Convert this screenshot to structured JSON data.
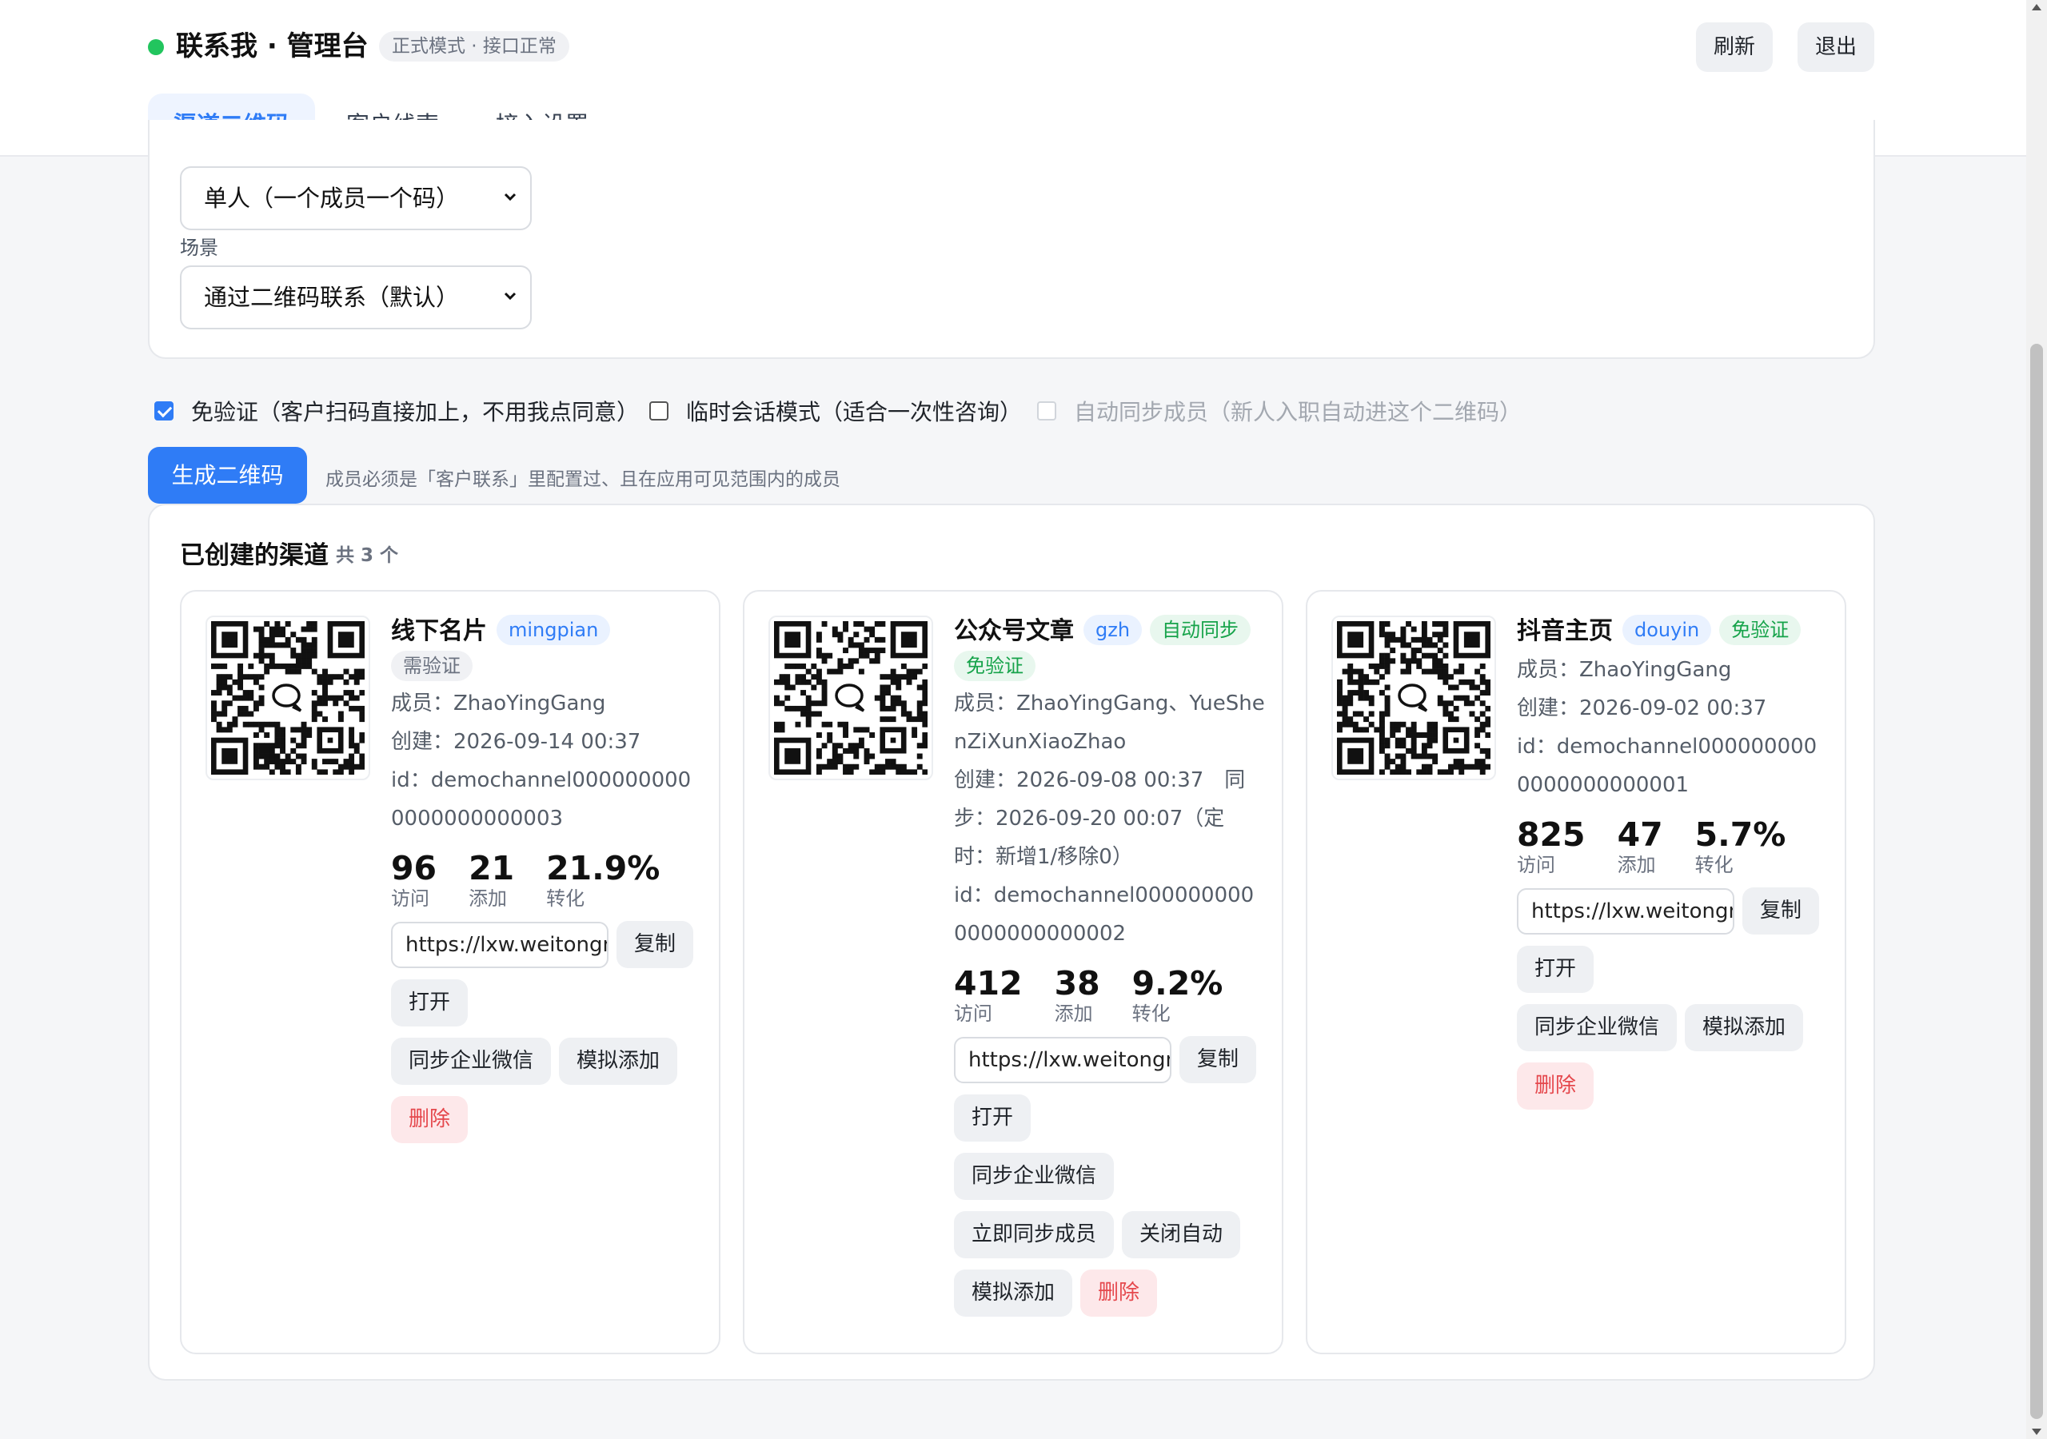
{
  "header": {
    "title": "联系我 · 管理台",
    "mode_badge": "正式模式 · 接口正常",
    "refresh_label": "刷新",
    "logout_label": "退出",
    "status_color": "#22c55e"
  },
  "tabs": [
    {
      "label": "渠道二维码",
      "active": true
    },
    {
      "label": "客户线索",
      "active": false
    },
    {
      "label": "接入设置",
      "active": false
    }
  ],
  "form": {
    "type_select": "单人（一个成员一个码）",
    "scene_label": "场景",
    "scene_select": "通过二维码联系（默认）"
  },
  "options": [
    {
      "label": "免验证（客户扫码直接加上，不用我点同意）",
      "checked": true,
      "disabled": false
    },
    {
      "label": "临时会话模式（适合一次性咨询）",
      "checked": false,
      "disabled": false
    },
    {
      "label": "自动同步成员（新人入职自动进这个二维码）",
      "checked": false,
      "disabled": true
    }
  ],
  "generate": {
    "button_label": "生成二维码",
    "hint": "成员必须是「客户联系」里配置过、且在应用可见范围内的成员"
  },
  "channels": {
    "title": "已创建的渠道",
    "count": "共 3 个",
    "cards": [
      {
        "name": "线下名片",
        "tags": [
          {
            "text": "mingpian",
            "kind": "blue"
          },
          {
            "text": "需验证",
            "kind": "gray"
          }
        ],
        "members": "成员：ZhaoYingGang",
        "created": "创建：2026-09-14 00:37",
        "id": "id：demochannel0000000000000000000003",
        "visits": "96",
        "visits_label": "访问",
        "adds": "21",
        "adds_label": "添加",
        "rate": "21.9%",
        "rate_label": "转化",
        "url": "https://lxw.weitongn",
        "copy": "复制",
        "open": "打开",
        "sync": "同步企业微信",
        "simulate": "模拟添加",
        "delete": "删除"
      },
      {
        "name": "公众号文章",
        "tags": [
          {
            "text": "gzh",
            "kind": "blue"
          },
          {
            "text": "自动同步",
            "kind": "green"
          },
          {
            "text": "免验证",
            "kind": "green"
          }
        ],
        "members": "成员：ZhaoYingGang、YueShenZiXunXiaoZhao",
        "created": "创建：2026-09-08 00:37　同步：2026-09-20 00:07（定时：新增1/移除0）",
        "id": "id：demochannel0000000000000000000002",
        "visits": "412",
        "visits_label": "访问",
        "adds": "38",
        "adds_label": "添加",
        "rate": "9.2%",
        "rate_label": "转化",
        "url": "https://lxw.weitongn",
        "copy": "复制",
        "open": "打开",
        "sync": "同步企业微信",
        "sync_now": "立即同步成员",
        "close_auto": "关闭自动",
        "simulate": "模拟添加",
        "delete": "删除"
      },
      {
        "name": "抖音主页",
        "tags": [
          {
            "text": "douyin",
            "kind": "blue"
          },
          {
            "text": "免验证",
            "kind": "green"
          }
        ],
        "members": "成员：ZhaoYingGang",
        "created": "创建：2026-09-02 00:37",
        "id": "id：demochannel0000000000000000000001",
        "visits": "825",
        "visits_label": "访问",
        "adds": "47",
        "adds_label": "添加",
        "rate": "5.7%",
        "rate_label": "转化",
        "url": "https://lxw.weitongn",
        "copy": "复制",
        "open": "打开",
        "sync": "同步企业微信",
        "simulate": "模拟添加",
        "delete": "删除"
      }
    ]
  },
  "colors": {
    "accent": "#2f7cf6",
    "danger": "#e5484d",
    "success": "#16a34a"
  }
}
